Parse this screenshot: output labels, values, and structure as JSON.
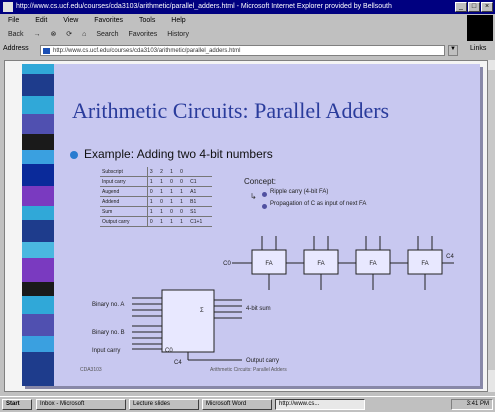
{
  "window": {
    "title": "http://www.cs.ucf.edu/courses/cda3103/arithmetic/parallel_adders.html - Microsoft Internet Explorer provided by Bellsouth"
  },
  "menu": {
    "items": [
      "File",
      "Edit",
      "View",
      "Favorites",
      "Tools",
      "Help"
    ]
  },
  "toolbar": {
    "back": "Back",
    "forward": "→",
    "stop": "⊗",
    "refresh": "⟳",
    "home": "⌂",
    "search": "Search",
    "favorites": "Favorites",
    "history": "History"
  },
  "address": {
    "label": "Address",
    "value": "http://www.cs.ucf.edu/courses/cda3103/arithmetic/parallel_adders.html",
    "go": "Links"
  },
  "slide": {
    "title": "Arithmetic Circuits: Parallel Adders",
    "bullet": "Example: Adding two 4-bit numbers",
    "table": [
      [
        "Subscript",
        "3",
        "2",
        "1",
        "0"
      ],
      [
        "Input carry",
        "1",
        "1",
        "0",
        "0",
        "C1"
      ],
      [
        "Augend",
        "0",
        "1",
        "1",
        "1",
        "A1"
      ],
      [
        "Addend",
        "1",
        "0",
        "1",
        "1",
        "B1"
      ],
      [
        "Sum",
        "1",
        "1",
        "0",
        "0",
        "S1"
      ],
      [
        "Output carry",
        "0",
        "1",
        "1",
        "1",
        "C1+1"
      ]
    ],
    "concept_heading": "Concept:",
    "concept_items": [
      "Ripple carry (4-bit FA)",
      "Propagation of C as input of next FA"
    ],
    "adder_labels": {
      "stage": "FA",
      "cin": "C0",
      "cout": "C4"
    },
    "block": {
      "in_a_label": "Binary no. A",
      "in_b_label": "Binary no. B",
      "in_carry_label": "Input carry",
      "chip_sum": "Σ",
      "sum_label": "4-bit sum",
      "out_carry_label": "Output carry",
      "cin_pin": "C0",
      "cout_pin": "C4"
    },
    "footer_left": "CDA3103",
    "footer_center": "Arithmetic Circuits: Parallel Adders"
  },
  "taskbar": {
    "start": "Start",
    "tasks": [
      "Inbox - Microsoft",
      "Lecture slides",
      "Microsoft Word",
      "http://www.cs..."
    ],
    "clock": "3:41 PM"
  },
  "colors": {
    "title_bar": "#000080",
    "slide_bg": "#c8c8f0",
    "slide_title": "#2a3c9c",
    "bullet": "#2a7cd0"
  }
}
